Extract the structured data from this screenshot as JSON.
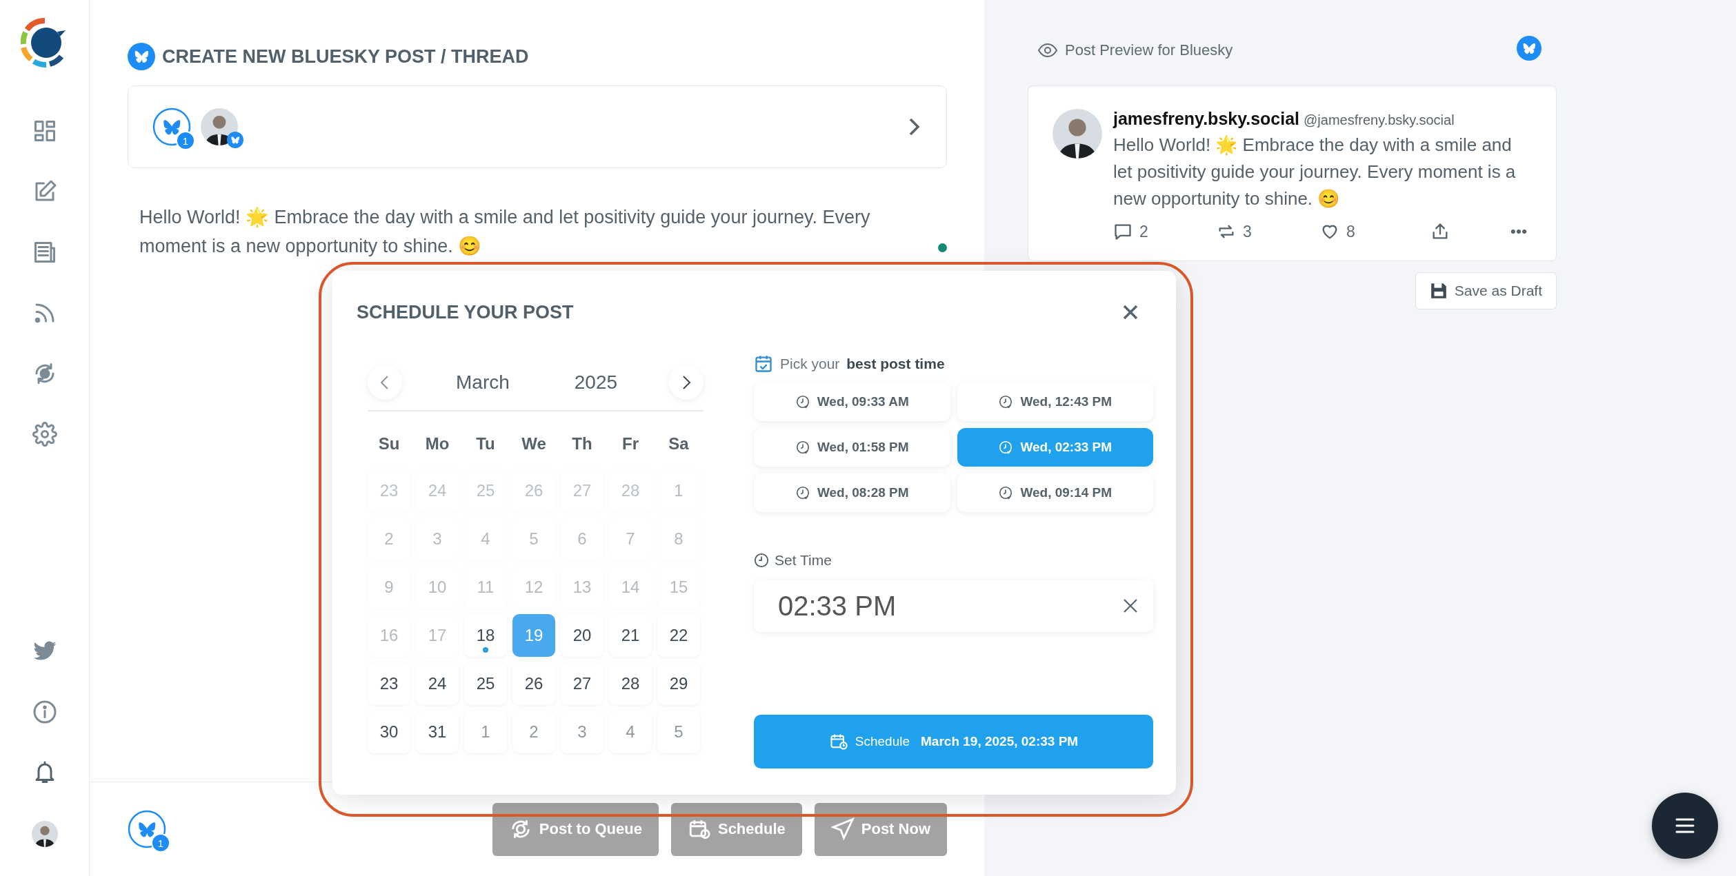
{
  "composer": {
    "title": "CREATE NEW BLUESKY POST / THREAD",
    "account_badge": "1",
    "text": "Hello World! 🌟 Embrace the day with a smile and let positivity guide your journey. Every moment is a new opportunity to shine. 😊"
  },
  "bottom_bar": {
    "account_badge": "1",
    "actions": [
      {
        "kind": "queue",
        "label": "Post to Queue",
        "disabled": true
      },
      {
        "kind": "schedule",
        "label": "Schedule",
        "disabled": true
      },
      {
        "kind": "now",
        "label": "Post Now",
        "disabled": true
      }
    ]
  },
  "preview": {
    "title": "Post Preview for Bluesky",
    "display_name": "jamesfreny.bsky.social",
    "handle": "@jamesfreny.bsky.social",
    "text": "Hello World! 🌟 Embrace the day with a smile and let positivity guide your journey. Every moment is a new opportunity to shine. 😊",
    "stats": [
      {
        "kind": "reply",
        "count": "2"
      },
      {
        "kind": "repost",
        "count": "3"
      },
      {
        "kind": "like",
        "count": "8"
      },
      {
        "kind": "share"
      },
      {
        "kind": "more"
      }
    ],
    "save_draft": "Save as Draft"
  },
  "modal": {
    "title": "SCHEDULE YOUR POST",
    "month": "March",
    "year": "2025",
    "weekdays": [
      "Su",
      "Mo",
      "Tu",
      "We",
      "Th",
      "Fr",
      "Sa"
    ],
    "days": [
      {
        "label": "23",
        "disabled": true,
        "other_month": true,
        "today": false,
        "selected": false
      },
      {
        "label": "24",
        "disabled": true,
        "other_month": true,
        "today": false,
        "selected": false
      },
      {
        "label": "25",
        "disabled": true,
        "other_month": true,
        "today": false,
        "selected": false
      },
      {
        "label": "26",
        "disabled": true,
        "other_month": true,
        "today": false,
        "selected": false
      },
      {
        "label": "27",
        "disabled": true,
        "other_month": true,
        "today": false,
        "selected": false
      },
      {
        "label": "28",
        "disabled": true,
        "other_month": true,
        "today": false,
        "selected": false
      },
      {
        "label": "1",
        "disabled": true,
        "other_month": false,
        "today": false,
        "selected": false
      },
      {
        "label": "2",
        "disabled": true,
        "other_month": false,
        "today": false,
        "selected": false
      },
      {
        "label": "3",
        "disabled": true,
        "other_month": false,
        "today": false,
        "selected": false
      },
      {
        "label": "4",
        "disabled": true,
        "other_month": false,
        "today": false,
        "selected": false
      },
      {
        "label": "5",
        "disabled": true,
        "other_month": false,
        "today": false,
        "selected": false
      },
      {
        "label": "6",
        "disabled": true,
        "other_month": false,
        "today": false,
        "selected": false
      },
      {
        "label": "7",
        "disabled": true,
        "other_month": false,
        "today": false,
        "selected": false
      },
      {
        "label": "8",
        "disabled": true,
        "other_month": false,
        "today": false,
        "selected": false
      },
      {
        "label": "9",
        "disabled": true,
        "other_month": false,
        "today": false,
        "selected": false
      },
      {
        "label": "10",
        "disabled": true,
        "other_month": false,
        "today": false,
        "selected": false
      },
      {
        "label": "11",
        "disabled": true,
        "other_month": false,
        "today": false,
        "selected": false
      },
      {
        "label": "12",
        "disabled": true,
        "other_month": false,
        "today": false,
        "selected": false
      },
      {
        "label": "13",
        "disabled": true,
        "other_month": false,
        "today": false,
        "selected": false
      },
      {
        "label": "14",
        "disabled": true,
        "other_month": false,
        "today": false,
        "selected": false
      },
      {
        "label": "15",
        "disabled": true,
        "other_month": false,
        "today": false,
        "selected": false
      },
      {
        "label": "16",
        "disabled": true,
        "other_month": false,
        "today": false,
        "selected": false
      },
      {
        "label": "17",
        "disabled": true,
        "other_month": false,
        "today": false,
        "selected": false
      },
      {
        "label": "18",
        "disabled": false,
        "other_month": false,
        "today": true,
        "selected": false
      },
      {
        "label": "19",
        "disabled": false,
        "other_month": false,
        "today": false,
        "selected": true
      },
      {
        "label": "20",
        "disabled": false,
        "other_month": false,
        "today": false,
        "selected": false
      },
      {
        "label": "21",
        "disabled": false,
        "other_month": false,
        "today": false,
        "selected": false
      },
      {
        "label": "22",
        "disabled": false,
        "other_month": false,
        "today": false,
        "selected": false
      },
      {
        "label": "23",
        "disabled": false,
        "other_month": false,
        "today": false,
        "selected": false
      },
      {
        "label": "24",
        "disabled": false,
        "other_month": false,
        "today": false,
        "selected": false
      },
      {
        "label": "25",
        "disabled": false,
        "other_month": false,
        "today": false,
        "selected": false
      },
      {
        "label": "26",
        "disabled": false,
        "other_month": false,
        "today": false,
        "selected": false
      },
      {
        "label": "27",
        "disabled": false,
        "other_month": false,
        "today": false,
        "selected": false
      },
      {
        "label": "28",
        "disabled": false,
        "other_month": false,
        "today": false,
        "selected": false
      },
      {
        "label": "29",
        "disabled": false,
        "other_month": false,
        "today": false,
        "selected": false
      },
      {
        "label": "30",
        "disabled": false,
        "other_month": false,
        "today": false,
        "selected": false
      },
      {
        "label": "31",
        "disabled": false,
        "other_month": false,
        "today": false,
        "selected": false
      },
      {
        "label": "1",
        "disabled": false,
        "other_month": true,
        "today": false,
        "selected": false
      },
      {
        "label": "2",
        "disabled": false,
        "other_month": true,
        "today": false,
        "selected": false
      },
      {
        "label": "3",
        "disabled": false,
        "other_month": true,
        "today": false,
        "selected": false
      },
      {
        "label": "4",
        "disabled": false,
        "other_month": true,
        "today": false,
        "selected": false
      },
      {
        "label": "5",
        "disabled": false,
        "other_month": true,
        "today": false,
        "selected": false
      }
    ],
    "best_time_label": "Pick your **best post time**",
    "slots": [
      {
        "label": "Wed, 09:33 AM",
        "selected": false
      },
      {
        "label": "Wed, 12:43 PM",
        "selected": false
      },
      {
        "label": "Wed, 01:58 PM",
        "selected": false
      },
      {
        "label": "Wed, 02:33 PM",
        "selected": true
      },
      {
        "label": "Wed, 08:28 PM",
        "selected": false
      },
      {
        "label": "Wed, 09:14 PM",
        "selected": false
      }
    ],
    "set_time_label": "Set Time",
    "time_value": "02:33 PM",
    "schedule_button": {
      "label": "Schedule",
      "date": "March 19, 2025, 02:33 PM"
    }
  }
}
